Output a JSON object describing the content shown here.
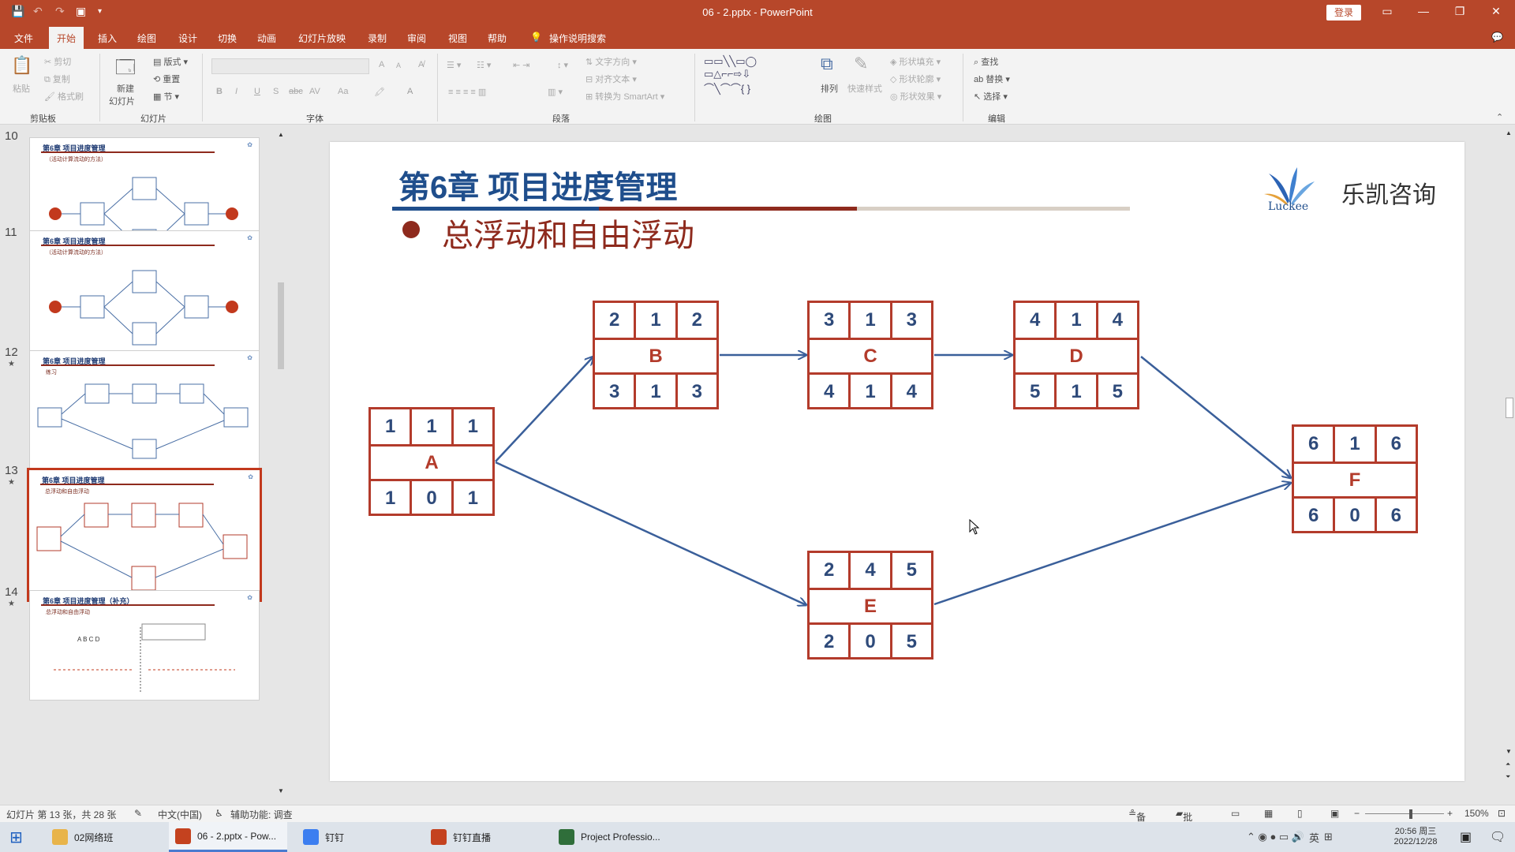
{
  "titlebar": {
    "title": "06 - 2.pptx  -  PowerPoint",
    "login_label": "登录",
    "qa_save": "💾",
    "qa_undo": "↶",
    "qa_redo": "↷",
    "qa_present": "▣",
    "qa_more": "▾",
    "win_ribbon": "▭",
    "win_min": "—",
    "win_max": "❐",
    "win_close": "✕"
  },
  "tabs": {
    "items": [
      "文件",
      "开始",
      "插入",
      "绘图",
      "设计",
      "切换",
      "动画",
      "幻灯片放映",
      "录制",
      "审阅",
      "视图",
      "帮助"
    ],
    "active": "开始",
    "tellme": "操作说明搜索",
    "comment_icon": "💬"
  },
  "ribbon": {
    "clipboard": {
      "paste": "粘贴",
      "cut": "剪切",
      "copy": "复制",
      "format_painter": "格式刷",
      "group": "剪贴板"
    },
    "slides": {
      "new_slide": "新建",
      "new_slide2": "幻灯片",
      "layout": "版式",
      "reset": "重置",
      "section": "节",
      "group": "幻灯片"
    },
    "font": {
      "group": "字体",
      "bold": "B",
      "italic": "I",
      "underline": "U",
      "shadow": "S",
      "strike": "abc",
      "spacing": "AV",
      "case": "Aa",
      "grow": "A",
      "shrink": "A"
    },
    "paragraph": {
      "group": "段落",
      "text_dir": "文字方向",
      "align_text": "对齐文本",
      "smartart": "转换为 SmartArt"
    },
    "drawing": {
      "group": "绘图",
      "arrange": "排列",
      "quick_styles": "快速样式",
      "fill": "形状填充",
      "outline": "形状轮廓",
      "effect": "形状效果"
    },
    "editing": {
      "group": "编辑",
      "find": "查找",
      "replace": "替换",
      "select": "选择"
    }
  },
  "thumbnails": [
    {
      "num": "10",
      "star": "",
      "title": "第6章 项目进度管理",
      "sub": "（活动计算流动的方法）"
    },
    {
      "num": "11",
      "star": "",
      "title": "第6章 项目进度管理",
      "sub": "（活动计算流动的方法）"
    },
    {
      "num": "12",
      "star": "★",
      "title": "第6章 项目进度管理",
      "sub": "练习"
    },
    {
      "num": "13",
      "star": "★",
      "title": "第6章 项目进度管理",
      "sub": "总浮动和自由浮动",
      "selected": true
    },
    {
      "num": "14",
      "star": "★",
      "title": "第6章 项目进度管理（补充）",
      "sub": "总浮动和自由浮动"
    }
  ],
  "slide": {
    "title": "第6章 项目进度管理",
    "subtitle": "总浮动和自由浮动",
    "brand": "乐凯咨询",
    "logo_text": "Luckee",
    "nodes": [
      {
        "name": "A",
        "top": [
          "1",
          "1",
          "1"
        ],
        "bottom": [
          "1",
          "0",
          "1"
        ]
      },
      {
        "name": "B",
        "top": [
          "2",
          "1",
          "2"
        ],
        "bottom": [
          "3",
          "1",
          "3"
        ]
      },
      {
        "name": "C",
        "top": [
          "3",
          "1",
          "3"
        ],
        "bottom": [
          "4",
          "1",
          "4"
        ]
      },
      {
        "name": "D",
        "top": [
          "4",
          "1",
          "4"
        ],
        "bottom": [
          "5",
          "1",
          "5"
        ]
      },
      {
        "name": "E",
        "top": [
          "2",
          "4",
          "5"
        ],
        "bottom": [
          "2",
          "0",
          "5"
        ]
      },
      {
        "name": "F",
        "top": [
          "6",
          "1",
          "6"
        ],
        "bottom": [
          "6",
          "0",
          "6"
        ]
      }
    ]
  },
  "status": {
    "slide_info": "幻灯片 第 13 张，共 28 张",
    "language": "中文(中国)",
    "accessibility": "辅助功能: 调查",
    "notes": "备注",
    "comments": "批注",
    "zoom": "150%"
  },
  "taskbar": {
    "start": "⊞",
    "items": [
      {
        "label": "02网络班",
        "color": "#e8b44a"
      },
      {
        "label": "06 - 2.pptx - Pow...",
        "color": "#c4421f",
        "active": true
      },
      {
        "label": "钉钉",
        "color": "#3c7ef0"
      },
      {
        "label": "钉钉直播",
        "color": "#c4421f"
      },
      {
        "label": "Project Professio...",
        "color": "#2f6e3a"
      }
    ],
    "time": "20:56 周三",
    "date": "2022/12/28",
    "ime": "英"
  }
}
